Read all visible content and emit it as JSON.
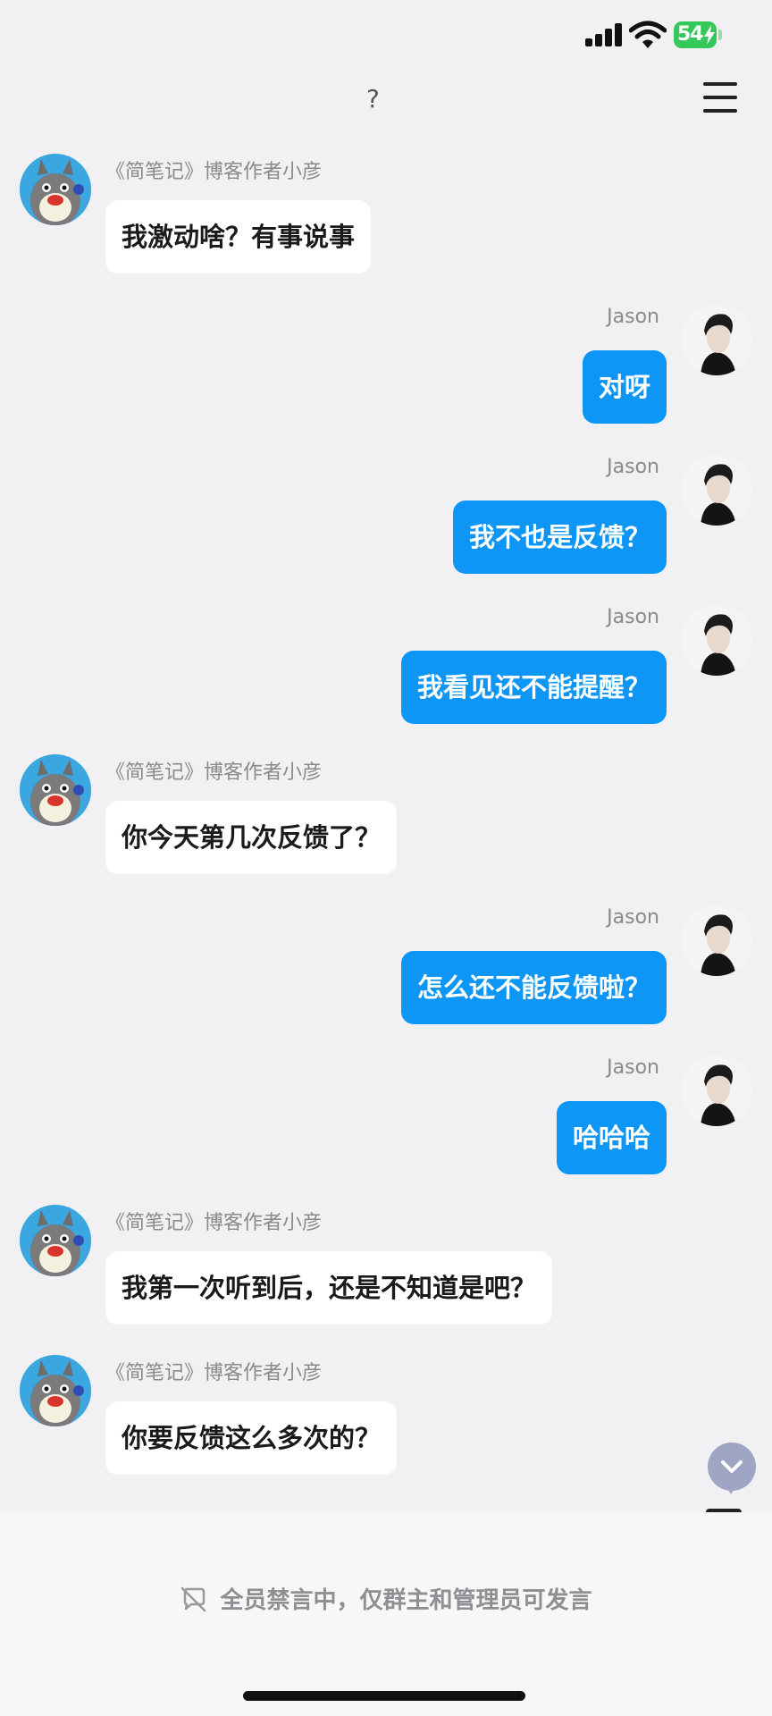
{
  "status_bar": {
    "battery": "54"
  },
  "header": {
    "glyph": "?"
  },
  "messages": [
    {
      "side": "left",
      "sender": "《简笔记》博客作者小彦",
      "text": "我激动啥？有事说事"
    },
    {
      "side": "right",
      "sender": "Jason",
      "text": "对呀"
    },
    {
      "side": "right",
      "sender": "Jason",
      "text": "我不也是反馈？"
    },
    {
      "side": "right",
      "sender": "Jason",
      "text": "我看见还不能提醒？"
    },
    {
      "side": "left",
      "sender": "《简笔记》博客作者小彦",
      "text": "你今天第几次反馈了？"
    },
    {
      "side": "right",
      "sender": "Jason",
      "text": "怎么还不能反馈啦？"
    },
    {
      "side": "right",
      "sender": "Jason",
      "text": "哈哈哈"
    },
    {
      "side": "left",
      "sender": "《简笔记》博客作者小彦",
      "text": "我第一次听到后，还是不知道是吧？"
    },
    {
      "side": "left",
      "sender": "《简笔记》博客作者小彦",
      "text": "你要反馈这么多次的？"
    }
  ],
  "footer": {
    "mute_notice": "全员禁言中，仅群主和管理员可发言"
  },
  "icons": {
    "signal": "signal-icon",
    "wifi": "wifi-icon",
    "battery": "battery-icon",
    "menu": "menu-icon",
    "scroll_down": "chevron-down-icon",
    "mute": "mute-icon",
    "avatar_left": "totoro-avatar",
    "avatar_right": "person-avatar"
  },
  "colors": {
    "background": "#f1f1f4",
    "my_bubble": "#0d96f6",
    "other_bubble": "#ffffff",
    "battery": "#34c759",
    "scroll_button": "#9ea6c4"
  }
}
